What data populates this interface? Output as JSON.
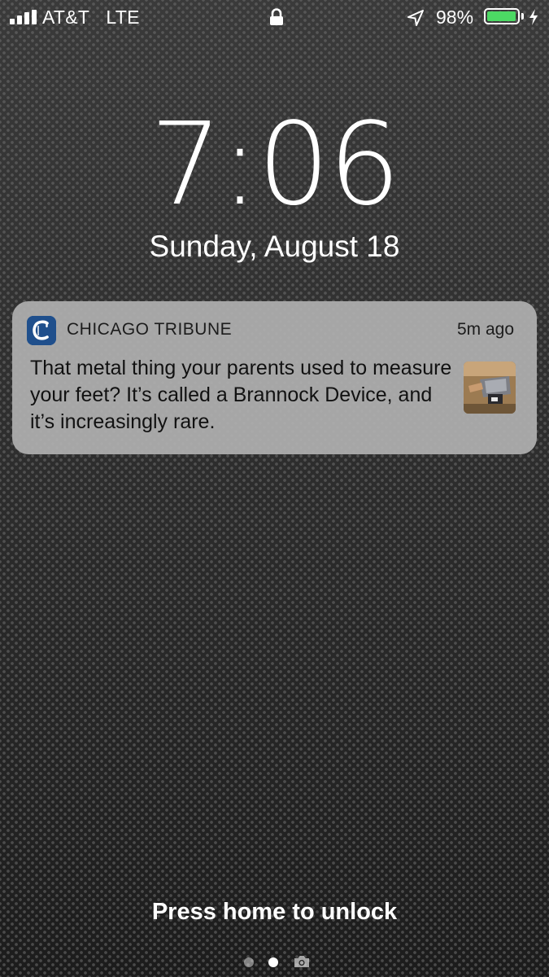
{
  "status_bar": {
    "carrier": "AT&T",
    "network": "LTE",
    "battery_percent": "98%",
    "battery_level": 0.98,
    "signal_bars": 4,
    "icons": [
      "signal-icon",
      "lock-icon",
      "location-arrow-icon",
      "battery-icon",
      "charging-bolt-icon"
    ],
    "battery_color": "#4cd964"
  },
  "lock_screen": {
    "time": "7:06",
    "date": "Sunday, August 18",
    "unlock_hint": "Press home to unlock"
  },
  "notification": {
    "app_name": "CHICAGO TRIBUNE",
    "time_ago": "5m ago",
    "body": "That metal thing your parents used to measure your feet? It’s called a Brannock Device, and it’s increasingly rare.",
    "app_icon": "chicago-tribune-logo-icon",
    "app_icon_color": "#1f4f8c"
  },
  "page_indicator": {
    "pages": 3,
    "active_index": 1,
    "last_page_icon": "camera-icon"
  }
}
